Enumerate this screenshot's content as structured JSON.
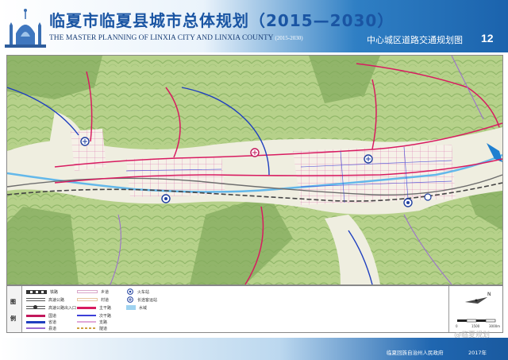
{
  "header": {
    "title_cn": "临夏市临夏县城市总体规划（2015—2030）",
    "title_en": "THE MASTER PLANNING OF LINXIA CITY AND LINXIA COUNTY",
    "title_en_years": "(2015-2030)",
    "sheet_title": "中心城区道路交通规划图",
    "sheet_number": "12"
  },
  "legend": {
    "heading_top": "图",
    "heading_bottom": "例",
    "items": [
      {
        "label": "铁路",
        "icon": "railway-line",
        "color": "#333333"
      },
      {
        "label": "高速公路",
        "icon": "expressway-line",
        "color": "#555555"
      },
      {
        "label": "高速公路出入口",
        "icon": "expressway-exit-icon",
        "color": "#333333"
      },
      {
        "label": "国道",
        "icon": "national-road-line",
        "color": "#c2185b"
      },
      {
        "label": "省道",
        "icon": "provincial-road-line",
        "color": "#1f3fbf"
      },
      {
        "label": "县道",
        "icon": "county-road-line",
        "color": "#9b6bd2"
      },
      {
        "label": "乡道",
        "icon": "township-road-line",
        "color": "#d9a7c9"
      },
      {
        "label": "村道",
        "icon": "village-road-line",
        "color": "#e8c6a0"
      },
      {
        "label": "主干路",
        "icon": "trunk-road-line",
        "color": "#d81b60"
      },
      {
        "label": "次干路",
        "icon": "secondary-road-line",
        "color": "#3b3fd8"
      },
      {
        "label": "支路",
        "icon": "branch-road-line",
        "color": "#e0a8d8"
      },
      {
        "label": "隧道",
        "icon": "tunnel-line",
        "color": "#d0a040"
      },
      {
        "label": "火车站",
        "icon": "train-station-icon",
        "color": "#1f3f9f"
      },
      {
        "label": "长途客运站",
        "icon": "bus-station-icon",
        "color": "#1f3f9f"
      },
      {
        "label": "水域",
        "icon": "water-area",
        "color": "#9fd3f0"
      }
    ]
  },
  "map": {
    "colors": {
      "mountain": "#b6d18a",
      "hill_dark": "#7fa85a",
      "valley": "#efeee0",
      "urban": "#f6f3ea",
      "river": "#63b8ea"
    }
  },
  "compass": {
    "north_label": "N",
    "scale_labels": [
      "0",
      "1500",
      "3000m"
    ]
  },
  "watermark": "@临夏规划",
  "footer": {
    "government": "临夏回族自治州人民政府",
    "year": "2017年"
  }
}
